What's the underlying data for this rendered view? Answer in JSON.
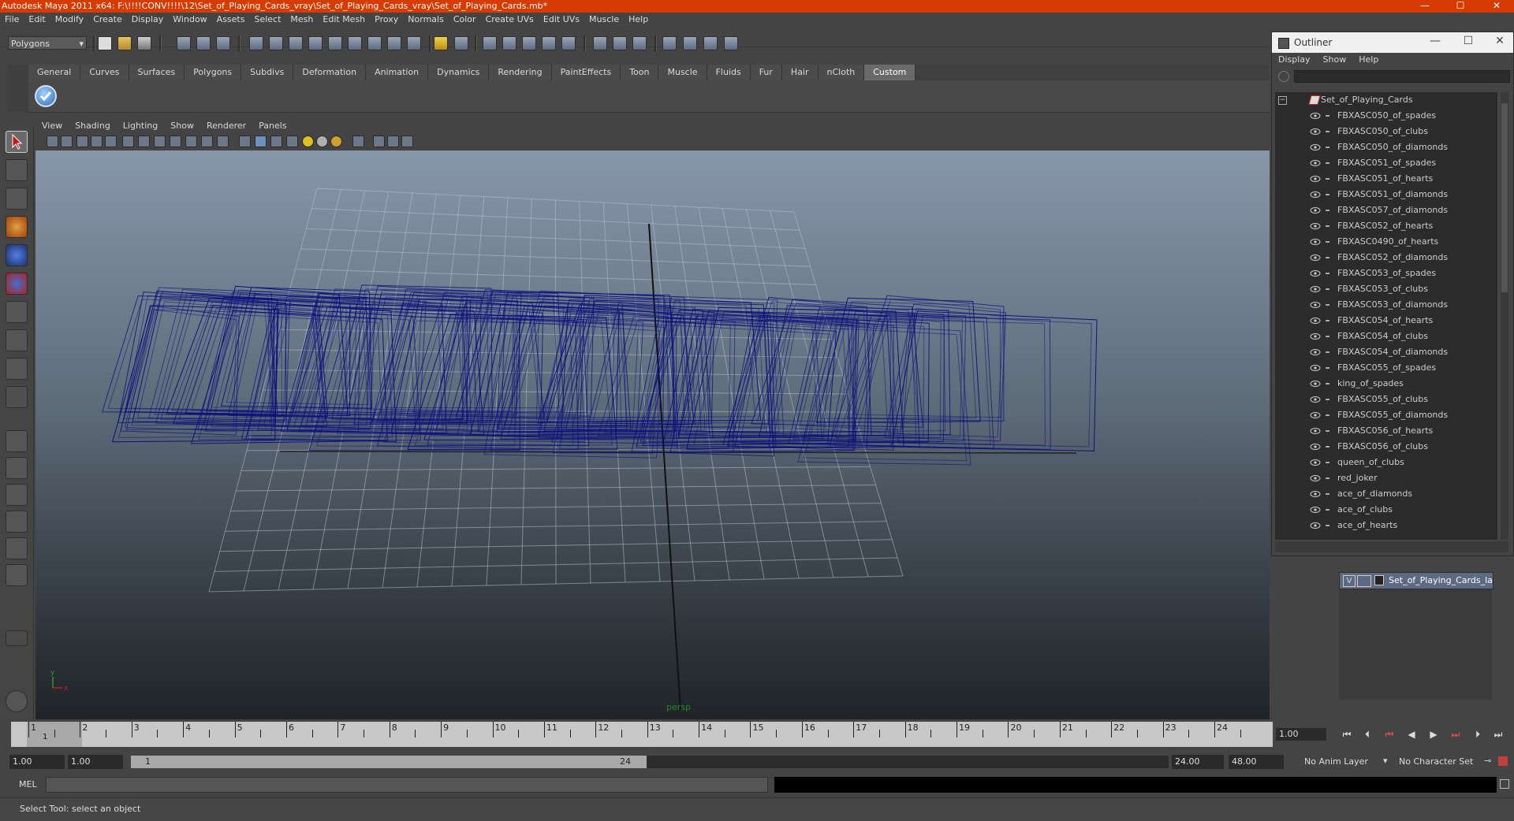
{
  "window": {
    "title": "Autodesk Maya 2011 x64: F:\\!!!!CONV!!!!\\12\\Set_of_Playing_Cards_vray\\Set_of_Playing_Cards_vray\\Set_of_Playing_Cards.mb*",
    "minimize": "—",
    "maximize": "☐",
    "close": "✕"
  },
  "menubar": [
    "File",
    "Edit",
    "Modify",
    "Create",
    "Display",
    "Window",
    "Assets",
    "Select",
    "Mesh",
    "Edit Mesh",
    "Proxy",
    "Normals",
    "Color",
    "Create UVs",
    "Edit UVs",
    "Muscle",
    "Help"
  ],
  "statusline": {
    "mode": "Polygons"
  },
  "shelf": {
    "tabs": [
      "General",
      "Curves",
      "Surfaces",
      "Polygons",
      "Subdivs",
      "Deformation",
      "Animation",
      "Dynamics",
      "Rendering",
      "PaintEffects",
      "Toon",
      "Muscle",
      "Fluids",
      "Fur",
      "Hair",
      "nCloth",
      "Custom"
    ],
    "active": "Custom"
  },
  "viewport": {
    "menus": [
      "View",
      "Shading",
      "Lighting",
      "Show",
      "Renderer",
      "Panels"
    ],
    "camera_label": "persp",
    "axis_y": "y",
    "axis_x": "x",
    "wire_color": "#0b0f7a"
  },
  "outliner": {
    "title": "Outliner",
    "menus": [
      "Display",
      "Show",
      "Help"
    ],
    "root": "Set_of_Playing_Cards",
    "items": [
      "FBXASC050_of_spades",
      "FBXASC050_of_clubs",
      "FBXASC050_of_diamonds",
      "FBXASC051_of_spades",
      "FBXASC051_of_hearts",
      "FBXASC051_of_diamonds",
      "FBXASC057_of_diamonds",
      "FBXASC052_of_hearts",
      "FBXASC0490_of_hearts",
      "FBXASC052_of_diamonds",
      "FBXASC053_of_spades",
      "FBXASC053_of_clubs",
      "FBXASC053_of_diamonds",
      "FBXASC054_of_hearts",
      "FBXASC054_of_clubs",
      "FBXASC054_of_diamonds",
      "FBXASC055_of_spades",
      "king_of_spades",
      "FBXASC055_of_clubs",
      "FBXASC055_of_diamonds",
      "FBXASC056_of_hearts",
      "FBXASC056_of_clubs",
      "queen_of_clubs",
      "red_joker",
      "ace_of_diamonds",
      "ace_of_clubs",
      "ace_of_hearts"
    ]
  },
  "layers": {
    "v": "V",
    "name": "Set_of_Playing_Cards_la"
  },
  "timeline": {
    "ticks": [
      "1",
      "2",
      "3",
      "4",
      "5",
      "6",
      "7",
      "8",
      "9",
      "10",
      "11",
      "12",
      "13",
      "14",
      "15",
      "16",
      "17",
      "18",
      "19",
      "20",
      "21",
      "22",
      "23",
      "24"
    ],
    "current_frame": "1",
    "current_time": "1.00"
  },
  "range": {
    "start": "1.00",
    "playback_start": "1.00",
    "knob_start": "1",
    "knob_end": "24",
    "playback_end": "24.00",
    "end": "48.00",
    "anim_layer": "No Anim Layer",
    "char_set": "No Character Set"
  },
  "cmd": {
    "label": "MEL"
  },
  "helpline": "Select Tool: select an object"
}
